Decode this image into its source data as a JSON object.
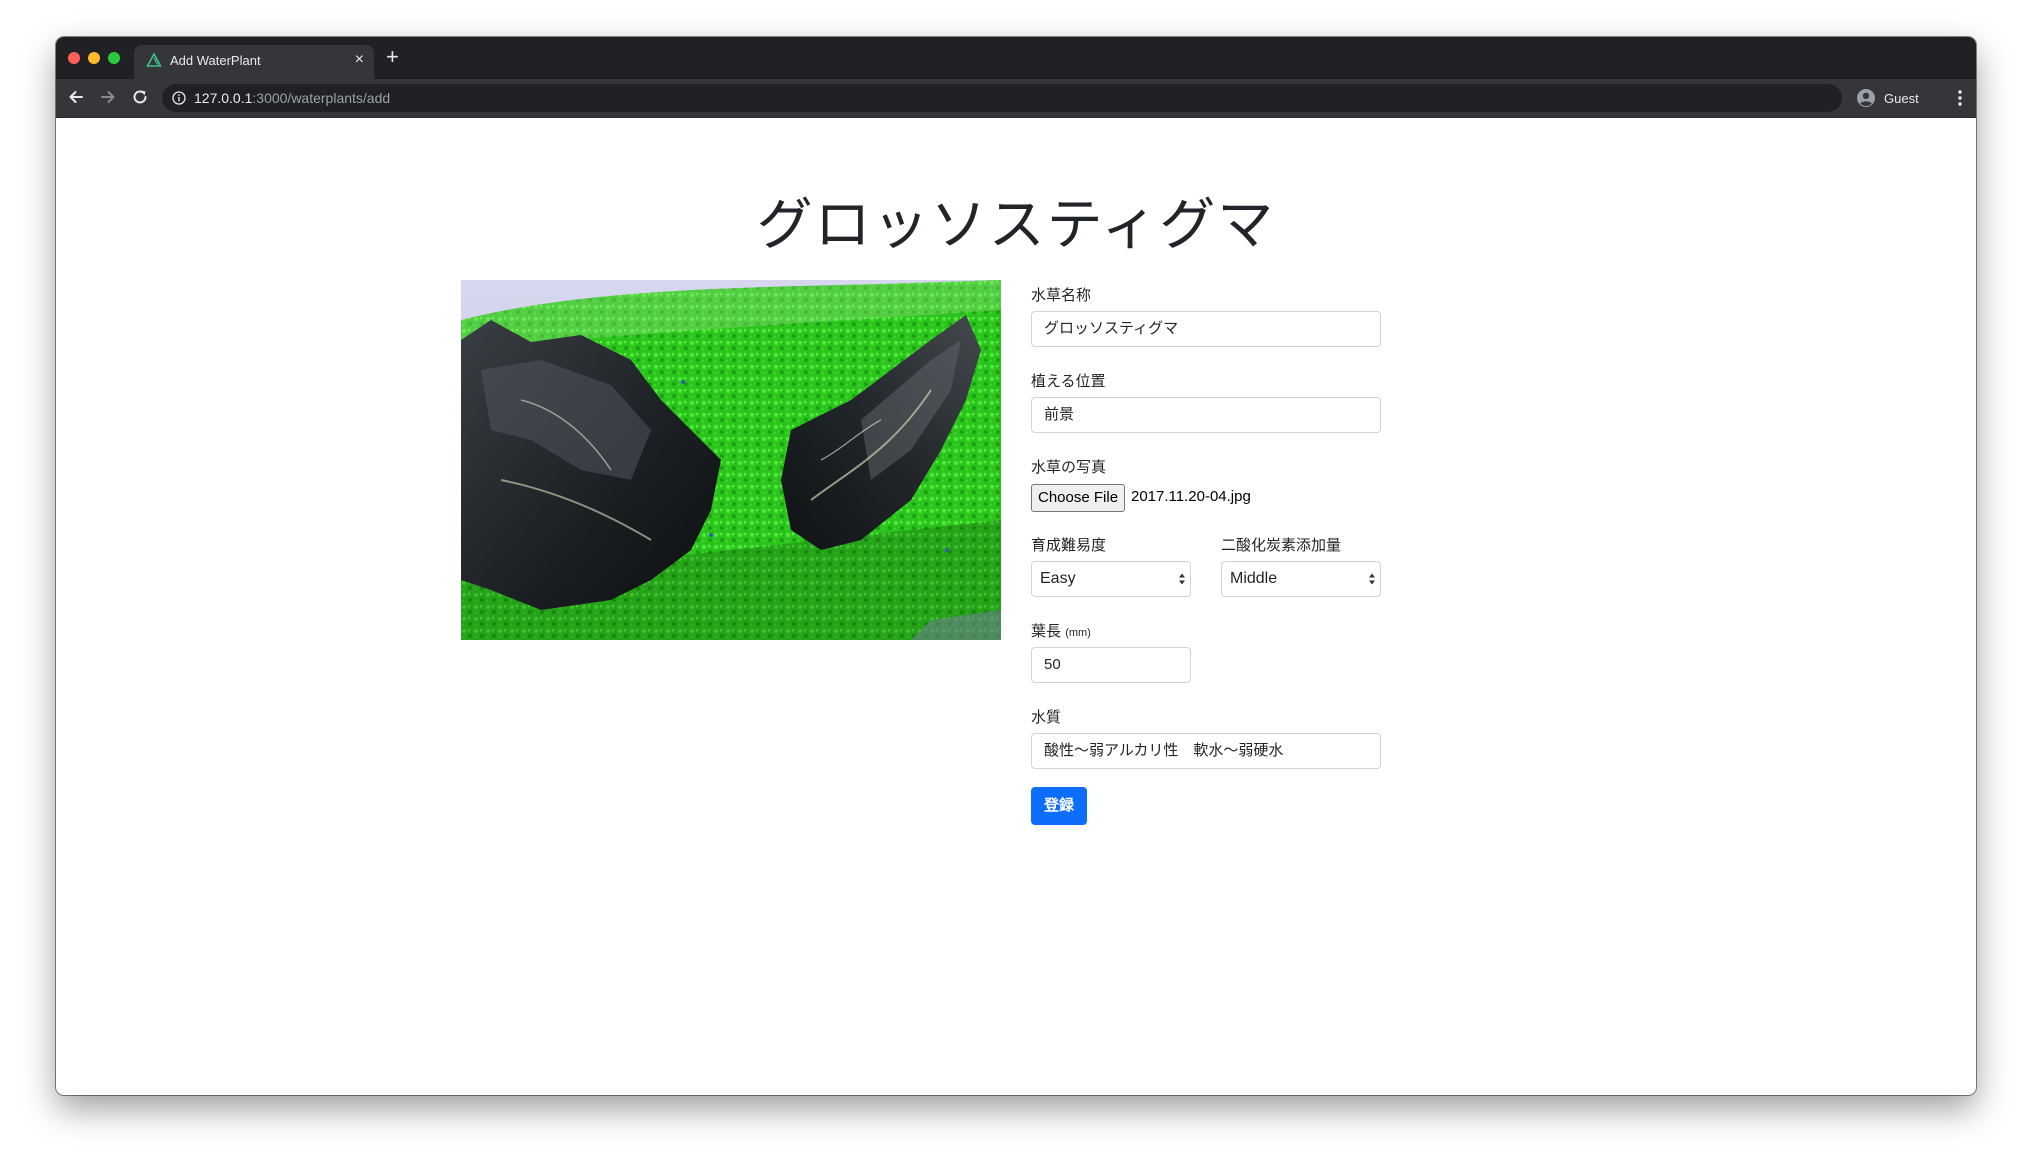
{
  "browser": {
    "tab_title": "Add WaterPlant",
    "tab_close": "×",
    "new_tab": "+",
    "url_host": "127.0.0.1",
    "url_path": ":3000/waterplants/add",
    "profile_label": "Guest"
  },
  "page": {
    "title": "グロッソスティグマ"
  },
  "form": {
    "name_label": "水草名称",
    "name_value": "グロッソスティグマ",
    "position_label": "植える位置",
    "position_value": "前景",
    "photo_label": "水草の写真",
    "file_button": "Choose File",
    "file_name": "2017.11.20-04.jpg",
    "difficulty_label": "育成難易度",
    "difficulty_value": "Easy",
    "co2_label": "二酸化炭素添加量",
    "co2_value": "Middle",
    "leaf_label": "葉長",
    "leaf_unit": "(mm)",
    "leaf_value": "50",
    "water_label": "水質",
    "water_value": "酸性〜弱アルカリ性　軟水〜弱硬水",
    "submit_label": "登録"
  },
  "icons": {
    "tab_favicon": "triangle-icon",
    "back": "arrow-left-icon",
    "forward": "arrow-right-icon",
    "reload": "reload-icon",
    "info": "info-icon",
    "profile": "account-circle-icon",
    "menu": "vertical-dots-icon"
  },
  "colors": {
    "primary": "#0d6efd",
    "browser_dark": "#202124",
    "browser_toolbar": "#35363a",
    "moss_green": "#2fd21e"
  }
}
